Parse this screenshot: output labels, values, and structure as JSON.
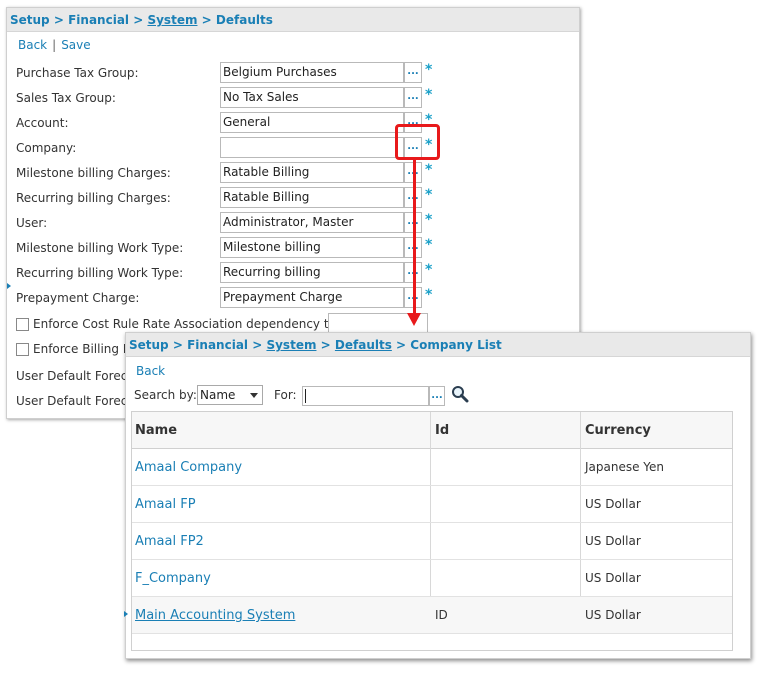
{
  "defaults_page": {
    "breadcrumb": {
      "setup": "Setup",
      "financial": "Financial",
      "system": "System",
      "defaults": "Defaults",
      "separator": ">"
    },
    "actions": {
      "back": "Back",
      "divider": "|",
      "save": "Save"
    },
    "fields": [
      {
        "label": "Purchase Tax Group:",
        "value": "Belgium Purchases"
      },
      {
        "label": "Sales Tax Group:",
        "value": "No Tax Sales"
      },
      {
        "label": "Account:",
        "value": "General"
      },
      {
        "label": "Company:",
        "value": ""
      },
      {
        "label": "Milestone billing Charges:",
        "value": "Ratable Billing"
      },
      {
        "label": "Recurring billing Charges:",
        "value": "Ratable Billing"
      },
      {
        "label": "User:",
        "value": "Administrator, Master"
      },
      {
        "label": "Milestone billing Work Type:",
        "value": "Milestone billing"
      },
      {
        "label": "Recurring billing Work Type:",
        "value": "Recurring billing"
      },
      {
        "label": "Prepayment Charge:",
        "value": "Prepayment Charge"
      }
    ],
    "lookup_label": "...",
    "required_mark": "*",
    "checkbox_1": "Enforce Cost Rule Rate Association dependency to:",
    "checkbox_2": "Enforce Billing Ru",
    "extra_1": "User Default Foreca",
    "extra_2": "User Default Foreca"
  },
  "company_list": {
    "breadcrumb": {
      "setup": "Setup",
      "financial": "Financial",
      "system": "System",
      "defaults": "Defaults",
      "company_list": "Company List",
      "separator": ">"
    },
    "back": "Back",
    "search_by_label": "Search by:",
    "search_by_value": "Name",
    "for_label": "For:",
    "for_value": "",
    "lookup_label": "...",
    "columns": {
      "name": "Name",
      "id": "Id",
      "currency": "Currency"
    },
    "rows": [
      {
        "name": "Amaal Company",
        "id": "",
        "currency": "Japanese Yen"
      },
      {
        "name": "Amaal FP",
        "id": "",
        "currency": "US Dollar"
      },
      {
        "name": "Amaal FP2",
        "id": "",
        "currency": "US Dollar"
      },
      {
        "name": "F_Company",
        "id": "",
        "currency": "US Dollar"
      },
      {
        "name": "Main Accounting System",
        "id": "ID",
        "currency": "US Dollar"
      }
    ]
  },
  "colors": {
    "link": "#1a7fb5",
    "highlight": "#e8191b",
    "required": "#1aa0c8",
    "header_bg": "#e9e9e9"
  },
  "icons": {
    "search": "magnifier-icon",
    "dropdown": "chevron-down-icon"
  }
}
